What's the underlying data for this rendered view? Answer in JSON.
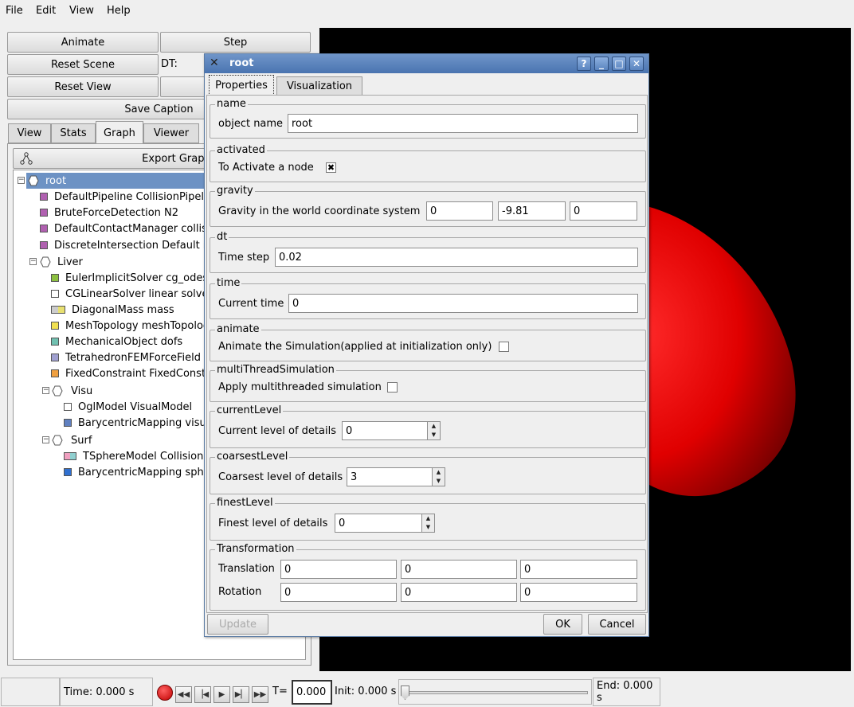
{
  "menu": {
    "file": "File",
    "edit": "Edit",
    "view": "View",
    "help": "Help"
  },
  "controls": {
    "animate": "Animate",
    "step": "Step",
    "reset_scene": "Reset Scene",
    "dt_label": "DT:",
    "reset_view": "Reset View",
    "save_caption": "Save Caption"
  },
  "left_tabs": [
    "View",
    "Stats",
    "Graph",
    "Viewer"
  ],
  "export_graph": "Export Graph..",
  "tree": [
    {
      "label": "root",
      "kind": "node"
    },
    {
      "label": "DefaultPipeline  CollisionPipeline",
      "color": "#b060b0"
    },
    {
      "label": "BruteForceDetection  N2",
      "color": "#b060b0"
    },
    {
      "label": "DefaultContactManager  collision response",
      "color": "#b060b0"
    },
    {
      "label": "DiscreteIntersection  Default intersection",
      "color": "#b060b0"
    },
    {
      "label": "Liver",
      "kind": "node"
    },
    {
      "label": "EulerImplicitSolver  cg_odesolver",
      "color": "#8cc040"
    },
    {
      "label": "CGLinearSolver  linear solver",
      "color": "#ffffff"
    },
    {
      "label": "DiagonalMass  mass",
      "color": "#e8e070"
    },
    {
      "label": "MeshTopology  meshTopology",
      "color": "#f0e050"
    },
    {
      "label": "MechanicalObject  dofs",
      "color": "#70c0b0"
    },
    {
      "label": "TetrahedronFEMForceField  FEM",
      "color": "#a0a0d0"
    },
    {
      "label": "FixedConstraint  FixedConstraint",
      "color": "#f0a040"
    },
    {
      "label": "Visu",
      "kind": "node"
    },
    {
      "label": "OglModel  VisualModel",
      "color": "#ffffff"
    },
    {
      "label": "BarycentricMapping  visual mapping",
      "color": "#6080c0"
    },
    {
      "label": "Surf",
      "kind": "node"
    },
    {
      "label": "TSphereModel  CollisionModel",
      "color": "#f0a0c0"
    },
    {
      "label": "BarycentricMapping  sphere mapping",
      "color": "#3070d0"
    }
  ],
  "dialog": {
    "title": "root",
    "tabs": [
      "Properties",
      "Visualization"
    ],
    "groups": {
      "name": {
        "title": "name",
        "label": "object name",
        "value": "root"
      },
      "activated": {
        "title": "activated",
        "label": "To Activate a node",
        "checked": true
      },
      "gravity": {
        "title": "gravity",
        "label": "Gravity in the world coordinate system",
        "x": "0",
        "y": "-9.81",
        "z": "0"
      },
      "dt": {
        "title": "dt",
        "label": "Time step",
        "value": "0.02"
      },
      "time": {
        "title": "time",
        "label": "Current time",
        "value": "0"
      },
      "animate": {
        "title": "animate",
        "label": "Animate the Simulation(applied at initialization only)",
        "checked": false
      },
      "multithread": {
        "title": "multiThreadSimulation",
        "label": "Apply multithreaded simulation",
        "checked": false
      },
      "currentLevel": {
        "title": "currentLevel",
        "label": "Current level of details",
        "value": "0"
      },
      "coarsestLevel": {
        "title": "coarsestLevel",
        "label": "Coarsest level of details",
        "value": "3"
      },
      "finestLevel": {
        "title": "finestLevel",
        "label": "Finest level of details",
        "value": "0"
      },
      "transformation": {
        "title": "Transformation",
        "translation_label": "Translation",
        "translation": [
          "0",
          "0",
          "0"
        ],
        "rotation_label": "Rotation",
        "rotation": [
          "0",
          "0",
          "0"
        ]
      }
    },
    "update": "Update",
    "ok": "OK",
    "cancel": "Cancel"
  },
  "status": {
    "time": "Time: 0.000 s",
    "t_label": "T=",
    "t_value": "0.000",
    "init": "Init: 0.000 s",
    "end": "End: 0.000 s"
  },
  "colors": {
    "titlebar": "#4a74b0",
    "selection": "#6d92c4",
    "object": "#ff0000"
  }
}
